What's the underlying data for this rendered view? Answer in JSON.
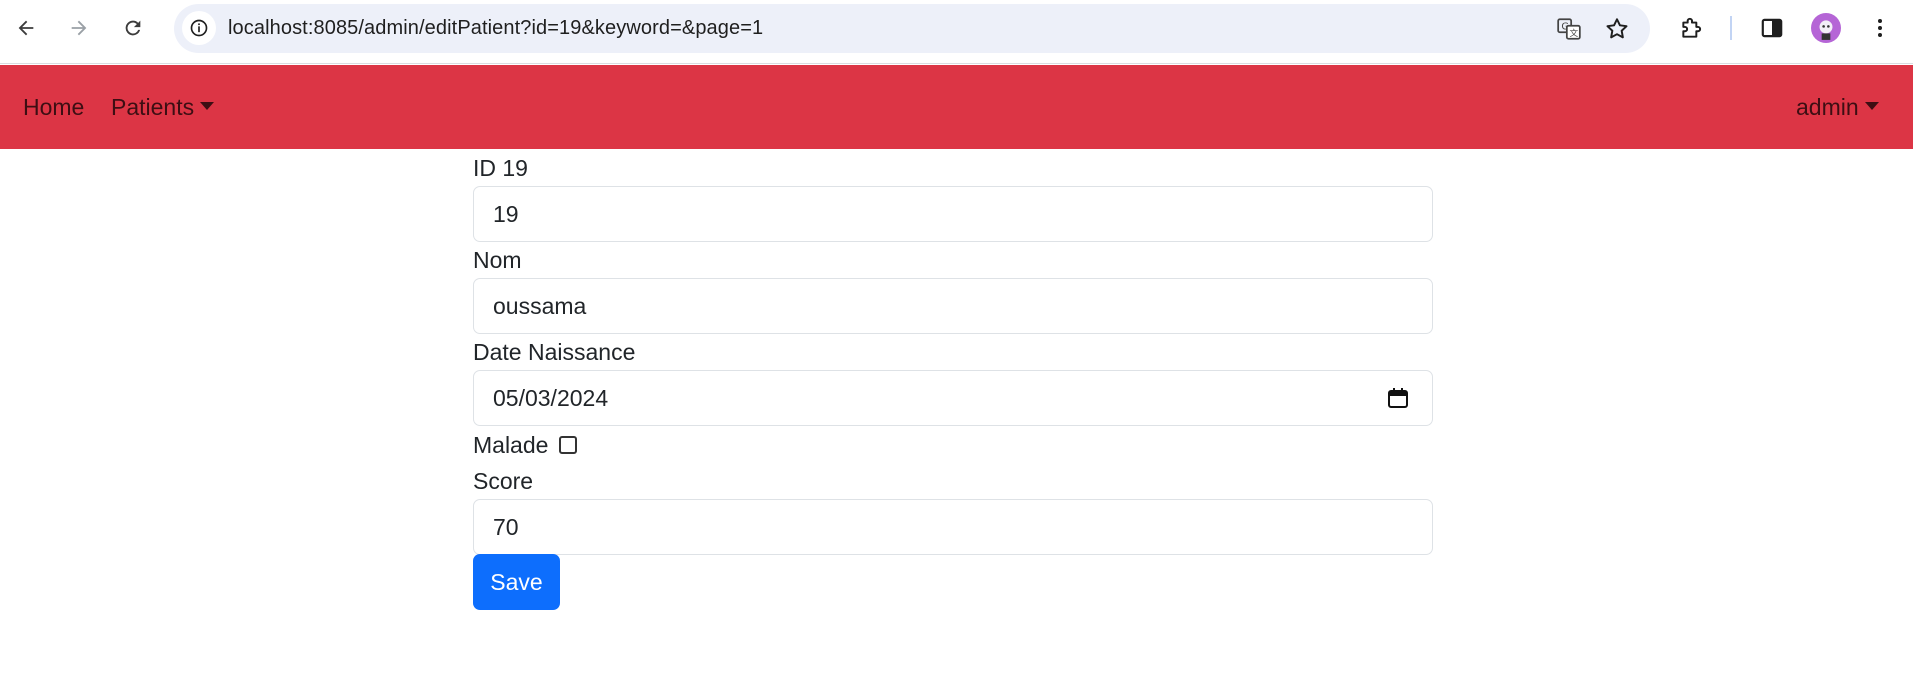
{
  "browser": {
    "url": "localhost:8085/admin/editPatient?id=19&keyword=&page=1",
    "icons": {
      "back": "arrow-left-icon",
      "forward": "arrow-right-icon",
      "reload": "reload-icon",
      "site_info": "info-icon",
      "translate": "translate-icon",
      "bookmark": "star-icon",
      "extensions": "puzzle-icon",
      "side_panel": "side-panel-icon",
      "profile": "avatar",
      "menu": "kebab-menu-icon"
    }
  },
  "navbar": {
    "color": "#dc3545",
    "home": "Home",
    "patients": "Patients",
    "user": "admin"
  },
  "form": {
    "id_label": "ID 19",
    "id_value": "19",
    "nom_label": "Nom",
    "nom_value": "oussama",
    "date_label": "Date Naissance",
    "date_value": "05/03/2024",
    "malade_label": "Malade",
    "malade_checked": false,
    "score_label": "Score",
    "score_value": "70",
    "save_label": "Save",
    "save_color": "#0d6efd"
  }
}
